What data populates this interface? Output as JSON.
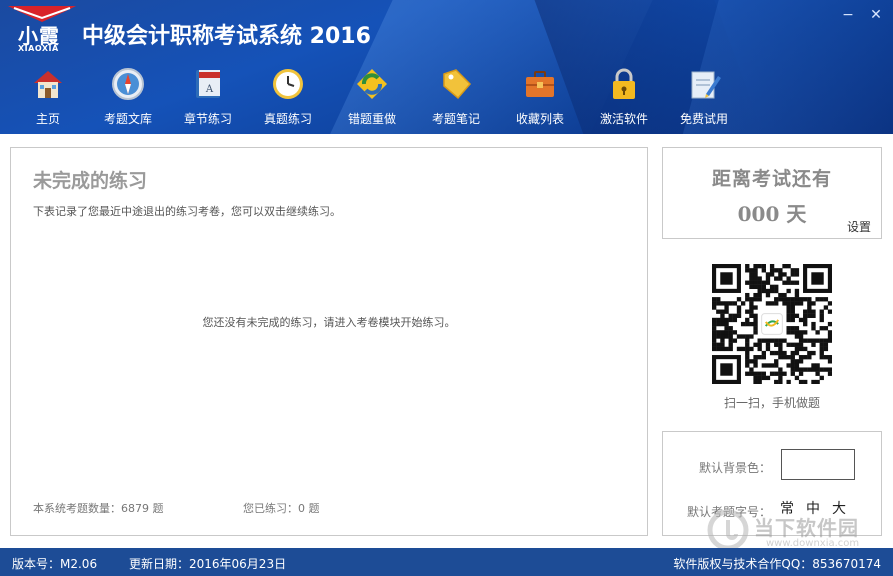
{
  "app": {
    "logo_main": "小霞",
    "logo_sub": "XIAOXIA",
    "title": "中级会计职称考试系统 2016",
    "minimize": "−",
    "close": "✕"
  },
  "toolbar": [
    {
      "label": "主页",
      "icon": "house-icon"
    },
    {
      "label": "考题文库",
      "icon": "compass-icon"
    },
    {
      "label": "章节练习",
      "icon": "book-icon"
    },
    {
      "label": "真题练习",
      "icon": "clock-icon"
    },
    {
      "label": "错题重做",
      "icon": "recycle-icon"
    },
    {
      "label": "考题笔记",
      "icon": "tag-icon"
    },
    {
      "label": "收藏列表",
      "icon": "briefcase-icon"
    },
    {
      "label": "激活软件",
      "icon": "lock-icon"
    },
    {
      "label": "免费试用",
      "icon": "pencil-paper-icon"
    }
  ],
  "main": {
    "title": "未完成的练习",
    "description": "下表记录了您最近中途退出的练习考卷，您可以双击继续练习。",
    "empty_message": "您还没有未完成的练习，请进入考卷模块开始练习。",
    "total_questions": "本系统考题数量：6879 题",
    "practiced": "您已练习：0 题"
  },
  "countdown": {
    "title": "距离考试还有",
    "days": "000 天",
    "settings_link": "设置"
  },
  "qr": {
    "caption": "扫一扫，手机做题"
  },
  "settings": {
    "bg_label": "默认背景色：",
    "font_label": "默认考题字号：",
    "font_options": [
      "常",
      "中",
      "大"
    ]
  },
  "watermark": {
    "text": "当下软件园",
    "url": "www.downxia.com"
  },
  "status": {
    "version": "版本号：M2.06",
    "updated": "更新日期：2016年06月23日",
    "copyright": "软件版权与技术合作QQ：853670174"
  },
  "colors": {
    "header_blue": "#1552b8",
    "status_blue": "#1d4c96",
    "logo_red": "#d8232a"
  }
}
